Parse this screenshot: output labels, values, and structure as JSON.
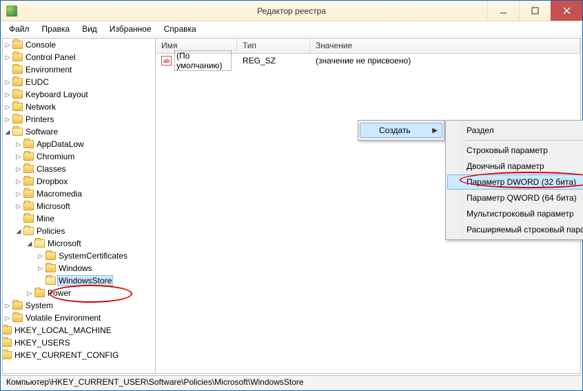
{
  "window": {
    "title": "Редактор реестра"
  },
  "menu": {
    "file": "Файл",
    "edit": "Правка",
    "view": "Вид",
    "favorites": "Избранное",
    "help": "Справка"
  },
  "tree": {
    "n0": "Console",
    "n1": "Control Panel",
    "n2": "Environment",
    "n3": "EUDC",
    "n4": "Keyboard Layout",
    "n5": "Network",
    "n6": "Printers",
    "n7": "Software",
    "n7_0": "AppDataLow",
    "n7_1": "Chromium",
    "n7_2": "Classes",
    "n7_3": "Dropbox",
    "n7_4": "Macromedia",
    "n7_5": "Microsoft",
    "n7_6": "Mine",
    "n7_7": "Policies",
    "n7_7_0": "Microsoft",
    "n7_7_0_0": "SystemCertificates",
    "n7_7_0_1": "Windows",
    "n7_7_0_2": "WindowsStore",
    "n7_7_1": "Power",
    "n8": "System",
    "n9": "Volatile Environment",
    "n10": "HKEY_LOCAL_MACHINE",
    "n11": "HKEY_USERS",
    "n12": "HKEY_CURRENT_CONFIG"
  },
  "columns": {
    "name": "Имя",
    "type": "Тип",
    "value": "Значение"
  },
  "row0": {
    "name": "(По умолчанию)",
    "type": "REG_SZ",
    "value": "(значение не присвоено)"
  },
  "ctx": {
    "create": "Создать",
    "section": "Раздел",
    "string": "Строковый параметр",
    "binary": "Двоичный параметр",
    "dword": "Параметр DWORD (32 бита)",
    "qword": "Параметр QWORD (64 бита)",
    "multistring": "Мультистроковый параметр",
    "expstring": "Расширяемый строковый параметр"
  },
  "status": {
    "path": "Компьютер\\HKEY_CURRENT_USER\\Software\\Policies\\Microsoft\\WindowsStore"
  }
}
